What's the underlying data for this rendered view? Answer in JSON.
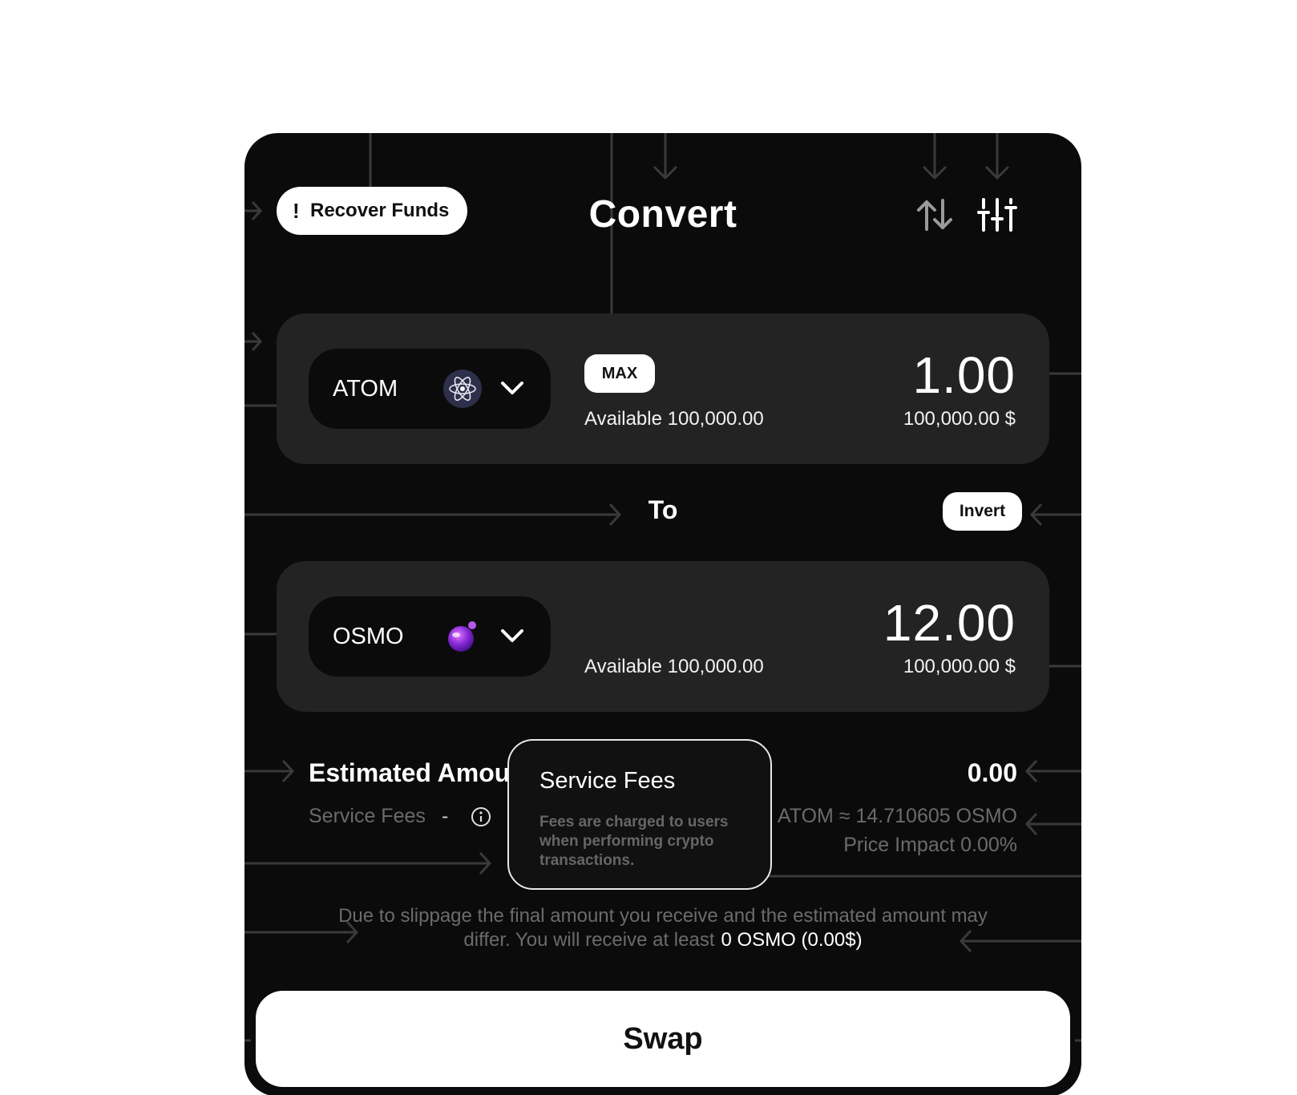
{
  "header": {
    "recover_icon": "!",
    "recover_label": "Recover Funds",
    "title": "Convert",
    "swap_direction_icon": "arrows-up-down-icon",
    "settings_icon": "sliders-icon"
  },
  "from": {
    "token": "ATOM",
    "token_icon": "atom-icon",
    "max_label": "MAX",
    "available": "Available 100,000.00",
    "amount": "1.00",
    "usd_value": "100,000.00 $"
  },
  "middle": {
    "to_label": "To",
    "invert_label": "Invert"
  },
  "to": {
    "token": "OSMO",
    "token_icon": "osmo-icon",
    "available": "Available 100,000.00",
    "amount": "12.00",
    "usd_value": "100,000.00 $"
  },
  "summary": {
    "estimated_label": "Estimated Amount",
    "estimated_value": "0.00",
    "service_fees_label": "Service Fees",
    "service_fees_value": "-",
    "rate": "ATOM ≈ 14.710605 OSMO",
    "price_impact": "Price Impact 0.00%"
  },
  "tooltip": {
    "title": "Service Fees",
    "text": "Fees are charged to users when performing crypto transactions."
  },
  "notice": {
    "text": "Due to slippage the final amount you receive and the estimated amount may differ. You will receive at least",
    "minimum": "0 OSMO (0.00$)"
  },
  "swap_label": "Swap",
  "colors": {
    "panel": "#0b0b0b",
    "card": "#232323",
    "muted_text": "#6b6b6b",
    "button_bg": "#ffffff",
    "osmo_purple": "#8b2bd9"
  }
}
